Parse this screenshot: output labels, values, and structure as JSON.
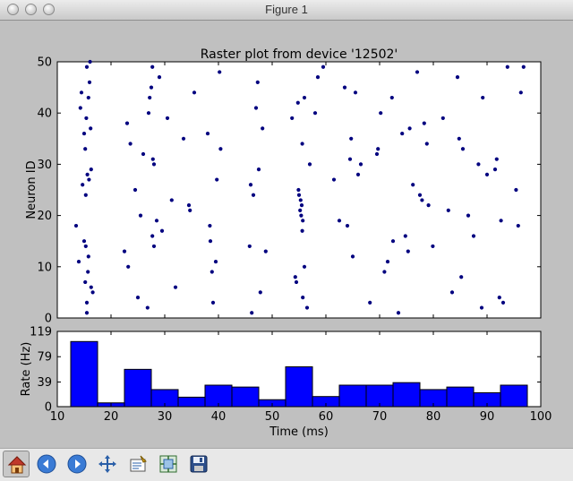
{
  "window": {
    "title": "Figure 1"
  },
  "toolbar": [
    {
      "name": "home-button",
      "icon": "home-icon",
      "active": true
    },
    {
      "name": "back-button",
      "icon": "back-arrow-icon",
      "active": false
    },
    {
      "name": "forward-button",
      "icon": "forward-arrow-icon",
      "active": false
    },
    {
      "name": "pan-button",
      "icon": "pan-arrows-icon",
      "active": false
    },
    {
      "name": "zoom-button",
      "icon": "zoom-rect-icon",
      "active": false
    },
    {
      "name": "subplots-button",
      "icon": "subplots-icon",
      "active": false
    },
    {
      "name": "save-button",
      "icon": "floppy-disk-icon",
      "active": false
    }
  ],
  "colors": {
    "marker": "#00007f",
    "bar": "#0000ff",
    "figure_bg": "#c0c0c0"
  },
  "chart_data": [
    {
      "type": "scatter",
      "title": "Raster plot from device '12502'",
      "xlabel": "",
      "ylabel": "Neuron ID",
      "xlim": [
        10,
        100
      ],
      "ylim": [
        0,
        50
      ],
      "yticks": [
        0,
        10,
        20,
        30,
        40,
        50
      ],
      "xticks": [
        10,
        20,
        30,
        40,
        50,
        60,
        70,
        80,
        90,
        100
      ],
      "show_xtick_labels": false,
      "grid": false,
      "points": [
        [
          13.5,
          18
        ],
        [
          14,
          11
        ],
        [
          14.3,
          41
        ],
        [
          14.5,
          44
        ],
        [
          14.7,
          26
        ],
        [
          15,
          36
        ],
        [
          15,
          15
        ],
        [
          15.2,
          33
        ],
        [
          15.2,
          7
        ],
        [
          15.3,
          24
        ],
        [
          15.3,
          14
        ],
        [
          15.4,
          39
        ],
        [
          15.5,
          1
        ],
        [
          15.5,
          3
        ],
        [
          15.5,
          49
        ],
        [
          15.6,
          28
        ],
        [
          15.7,
          9
        ],
        [
          15.8,
          12
        ],
        [
          15.8,
          43
        ],
        [
          15.9,
          27
        ],
        [
          16,
          46
        ],
        [
          16.1,
          50
        ],
        [
          16.2,
          37
        ],
        [
          16.3,
          29
        ],
        [
          16.3,
          6
        ],
        [
          16.6,
          5
        ],
        [
          22.5,
          13
        ],
        [
          23,
          38
        ],
        [
          23.2,
          10
        ],
        [
          23.6,
          34
        ],
        [
          24.5,
          25
        ],
        [
          25,
          4
        ],
        [
          25.5,
          20
        ],
        [
          26,
          32
        ],
        [
          26.8,
          2
        ],
        [
          27,
          40
        ],
        [
          27.2,
          43
        ],
        [
          27.5,
          45
        ],
        [
          27.7,
          16
        ],
        [
          27.7,
          49
        ],
        [
          27.8,
          31
        ],
        [
          28,
          30
        ],
        [
          28,
          14
        ],
        [
          28.5,
          19
        ],
        [
          29,
          47
        ],
        [
          29.5,
          17
        ],
        [
          30.5,
          39
        ],
        [
          31.3,
          23
        ],
        [
          32,
          6
        ],
        [
          33.5,
          35
        ],
        [
          34.5,
          22
        ],
        [
          34.7,
          21
        ],
        [
          35.5,
          44
        ],
        [
          38,
          36
        ],
        [
          38.4,
          18
        ],
        [
          38.5,
          15
        ],
        [
          38.8,
          9
        ],
        [
          39,
          3
        ],
        [
          39.5,
          11
        ],
        [
          39.7,
          27
        ],
        [
          40.2,
          48
        ],
        [
          40.4,
          33
        ],
        [
          45.8,
          14
        ],
        [
          46,
          26
        ],
        [
          46.2,
          1
        ],
        [
          46.5,
          24
        ],
        [
          47,
          41
        ],
        [
          47.3,
          46
        ],
        [
          47.5,
          29
        ],
        [
          47.8,
          5
        ],
        [
          48.2,
          37
        ],
        [
          48.8,
          13
        ],
        [
          53.7,
          39
        ],
        [
          54.3,
          8
        ],
        [
          54.5,
          7
        ],
        [
          54.8,
          42
        ],
        [
          54.9,
          25
        ],
        [
          55,
          24
        ],
        [
          55.2,
          21
        ],
        [
          55.3,
          23
        ],
        [
          55.4,
          20
        ],
        [
          55.5,
          22
        ],
        [
          55.6,
          17
        ],
        [
          55.7,
          19
        ],
        [
          55.6,
          34
        ],
        [
          55.7,
          4
        ],
        [
          56,
          10
        ],
        [
          56,
          43
        ],
        [
          56.5,
          2
        ],
        [
          57,
          30
        ],
        [
          58,
          40
        ],
        [
          58.5,
          47
        ],
        [
          59.5,
          49
        ],
        [
          61.5,
          27
        ],
        [
          62.5,
          19
        ],
        [
          63.5,
          45
        ],
        [
          64,
          18
        ],
        [
          64.5,
          31
        ],
        [
          64.7,
          35
        ],
        [
          65,
          12
        ],
        [
          65.5,
          44
        ],
        [
          66,
          28
        ],
        [
          66.5,
          30
        ],
        [
          68.2,
          3
        ],
        [
          69.5,
          32
        ],
        [
          69.7,
          33
        ],
        [
          70.2,
          40
        ],
        [
          70.9,
          9
        ],
        [
          71.5,
          11
        ],
        [
          72.3,
          43
        ],
        [
          72.5,
          15
        ],
        [
          73.5,
          1
        ],
        [
          74.2,
          36
        ],
        [
          74.8,
          16
        ],
        [
          75.3,
          13
        ],
        [
          75.6,
          37
        ],
        [
          76.2,
          26
        ],
        [
          77,
          48
        ],
        [
          77.5,
          24
        ],
        [
          77.9,
          23
        ],
        [
          78.3,
          38
        ],
        [
          78.8,
          34
        ],
        [
          79.1,
          22
        ],
        [
          79.9,
          14
        ],
        [
          81.8,
          39
        ],
        [
          82.8,
          21
        ],
        [
          83.5,
          5
        ],
        [
          84.5,
          47
        ],
        [
          84.8,
          35
        ],
        [
          85.2,
          8
        ],
        [
          85.5,
          33
        ],
        [
          86.5,
          20
        ],
        [
          87.5,
          16
        ],
        [
          88.4,
          30
        ],
        [
          89,
          2
        ],
        [
          89.2,
          43
        ],
        [
          90,
          28
        ],
        [
          91.5,
          29
        ],
        [
          91.8,
          31
        ],
        [
          92.3,
          4
        ],
        [
          92.6,
          19
        ],
        [
          93,
          3
        ],
        [
          93.8,
          49
        ],
        [
          95.4,
          25
        ],
        [
          95.8,
          18
        ],
        [
          96.3,
          44
        ],
        [
          96.8,
          49
        ]
      ]
    },
    {
      "type": "bar",
      "title": "",
      "xlabel": "Time (ms)",
      "ylabel": "Rate (Hz)",
      "xlim": [
        10,
        100
      ],
      "ylim": [
        0,
        119
      ],
      "yticks": [
        0,
        39,
        79,
        119
      ],
      "xticks": [
        10,
        20,
        30,
        40,
        50,
        60,
        70,
        80,
        90,
        100
      ],
      "grid": false,
      "bin_edges": [
        12.5,
        17.5,
        22.5,
        27.5,
        32.5,
        37.5,
        42.5,
        47.5,
        52.5,
        57.5,
        62.5,
        67.5,
        72.5,
        77.5,
        82.5,
        87.5,
        92.5,
        97.5
      ],
      "values": [
        103,
        6,
        59,
        27,
        15,
        34,
        31,
        11,
        63,
        16,
        34,
        34,
        38,
        27,
        31,
        22,
        34
      ]
    }
  ]
}
